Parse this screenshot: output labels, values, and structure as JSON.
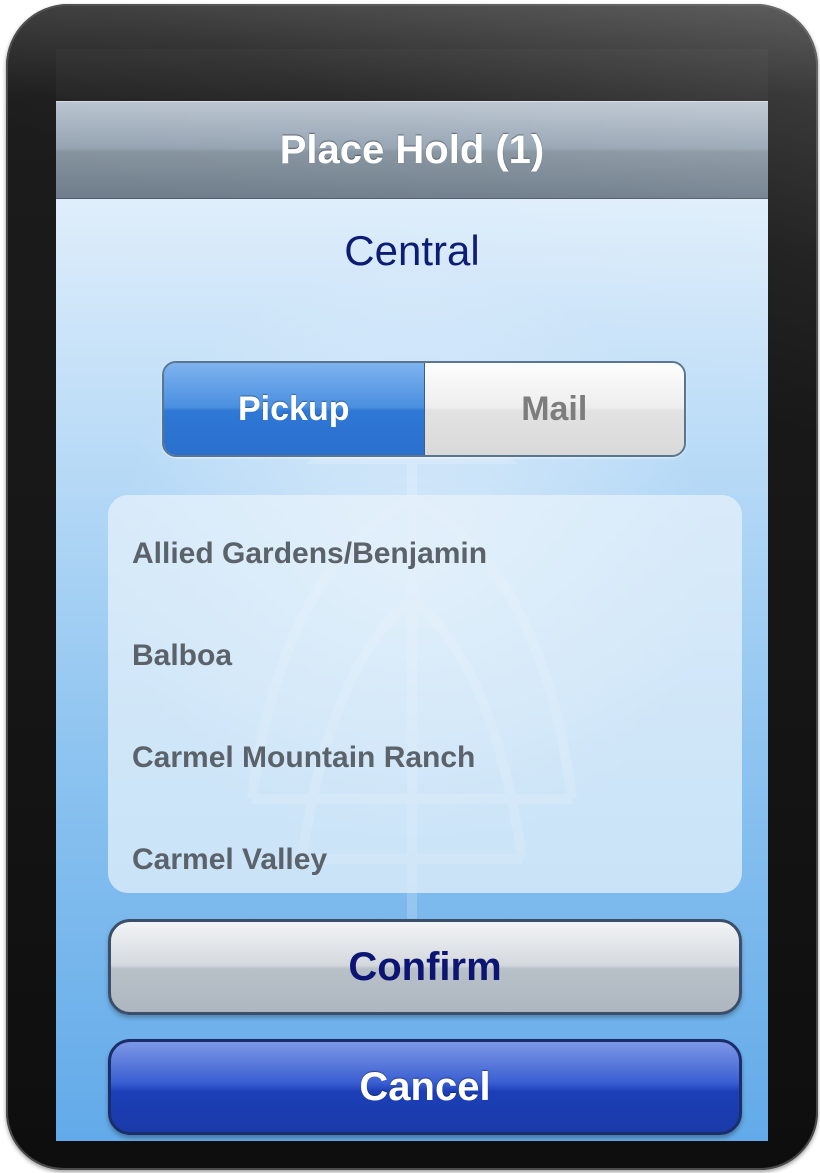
{
  "header": {
    "title": "Place Hold (1)"
  },
  "main": {
    "branch_name": "Central",
    "delivery_toggle": {
      "options": [
        "Pickup",
        "Mail"
      ],
      "selected": "Pickup"
    },
    "branch_picker": {
      "items": [
        "Allied Gardens/Benjamin",
        "Balboa",
        "Carmel Mountain Ranch",
        "Carmel Valley"
      ]
    },
    "actions": {
      "confirm_label": "Confirm",
      "cancel_label": "Cancel"
    }
  },
  "colors": {
    "title_text": "#ffffff",
    "branch_text": "#0b1a73",
    "active_segment": "#2f78d6",
    "confirm_text": "#0d1573",
    "cancel_button": "#1c3fb8"
  }
}
